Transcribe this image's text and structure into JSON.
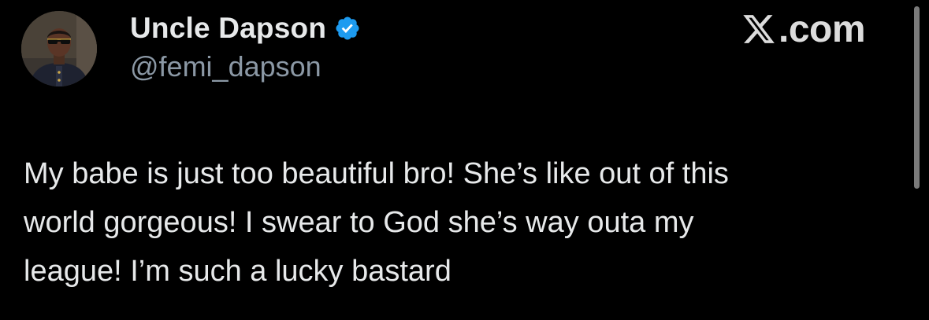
{
  "tweet": {
    "author": {
      "display_name": "Uncle Dapson",
      "handle": "@femi_dapson",
      "verified": true,
      "verified_icon": "verified-badge-icon",
      "avatar_icon": "profile-photo-avatar"
    },
    "text_lines": [
      "My babe is just too beautiful bro! She’s like out of this",
      "world gorgeous! I swear to God she’s way outa my",
      "league! I’m such a lucky bastard"
    ]
  },
  "watermark": {
    "text": ".com",
    "logo_icon": "x-logo-icon"
  },
  "colors": {
    "background": "#000000",
    "primary_text": "#e7e9ea",
    "secondary_text": "#8b98a5",
    "verified_blue": "#1d9bf0",
    "scrollbar": "#7a7a7a"
  }
}
